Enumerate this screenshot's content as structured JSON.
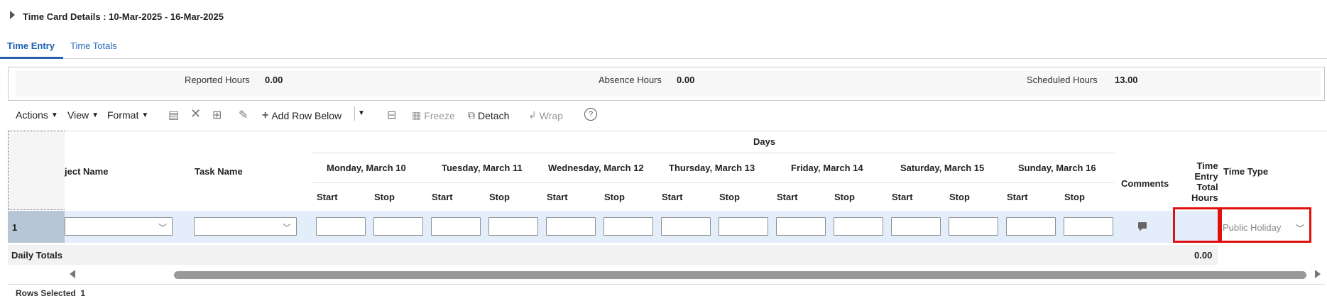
{
  "header": {
    "title": "Time Card Details : 10-Mar-2025 - 16-Mar-2025"
  },
  "tabs": [
    {
      "label": "Time Entry",
      "active": true
    },
    {
      "label": "Time Totals",
      "active": false
    }
  ],
  "summary": {
    "reported": {
      "label": "Reported Hours",
      "value": "0.00"
    },
    "absence": {
      "label": "Absence Hours",
      "value": "0.00"
    },
    "scheduled": {
      "label": "Scheduled Hours",
      "value": "13.00"
    }
  },
  "toolbar": {
    "actions": "Actions",
    "view": "View",
    "format": "Format",
    "add_row_below": "Add Row Below",
    "freeze": "Freeze",
    "detach": "Detach",
    "wrap": "Wrap",
    "help": "?"
  },
  "grid": {
    "days_label": "Days",
    "project_name": "ject Name",
    "task_name": "Task Name",
    "days": [
      {
        "label": "Monday, March 10"
      },
      {
        "label": "Tuesday, March 11"
      },
      {
        "label": "Wednesday, March 12"
      },
      {
        "label": "Thursday, March 13"
      },
      {
        "label": "Friday, March 14"
      },
      {
        "label": "Saturday, March 15"
      },
      {
        "label": "Sunday, March 16"
      }
    ],
    "start_label": "Start",
    "stop_label": "Stop",
    "comments": "Comments",
    "time_entry_total_hours": [
      "Time",
      "Entry",
      "Total",
      "Hours"
    ],
    "time_type": "Time Type",
    "rows": [
      {
        "number": "1",
        "time_type_value": "Public Holiday"
      }
    ],
    "daily_totals_label": "Daily Totals",
    "daily_totals_value": "0.00",
    "rows_selected_label": "Rows Selected",
    "rows_selected_count": "1"
  },
  "colors": {
    "accent": "#2b5fb0",
    "highlight": "#e01010",
    "row_selected": "#e4eefa"
  }
}
